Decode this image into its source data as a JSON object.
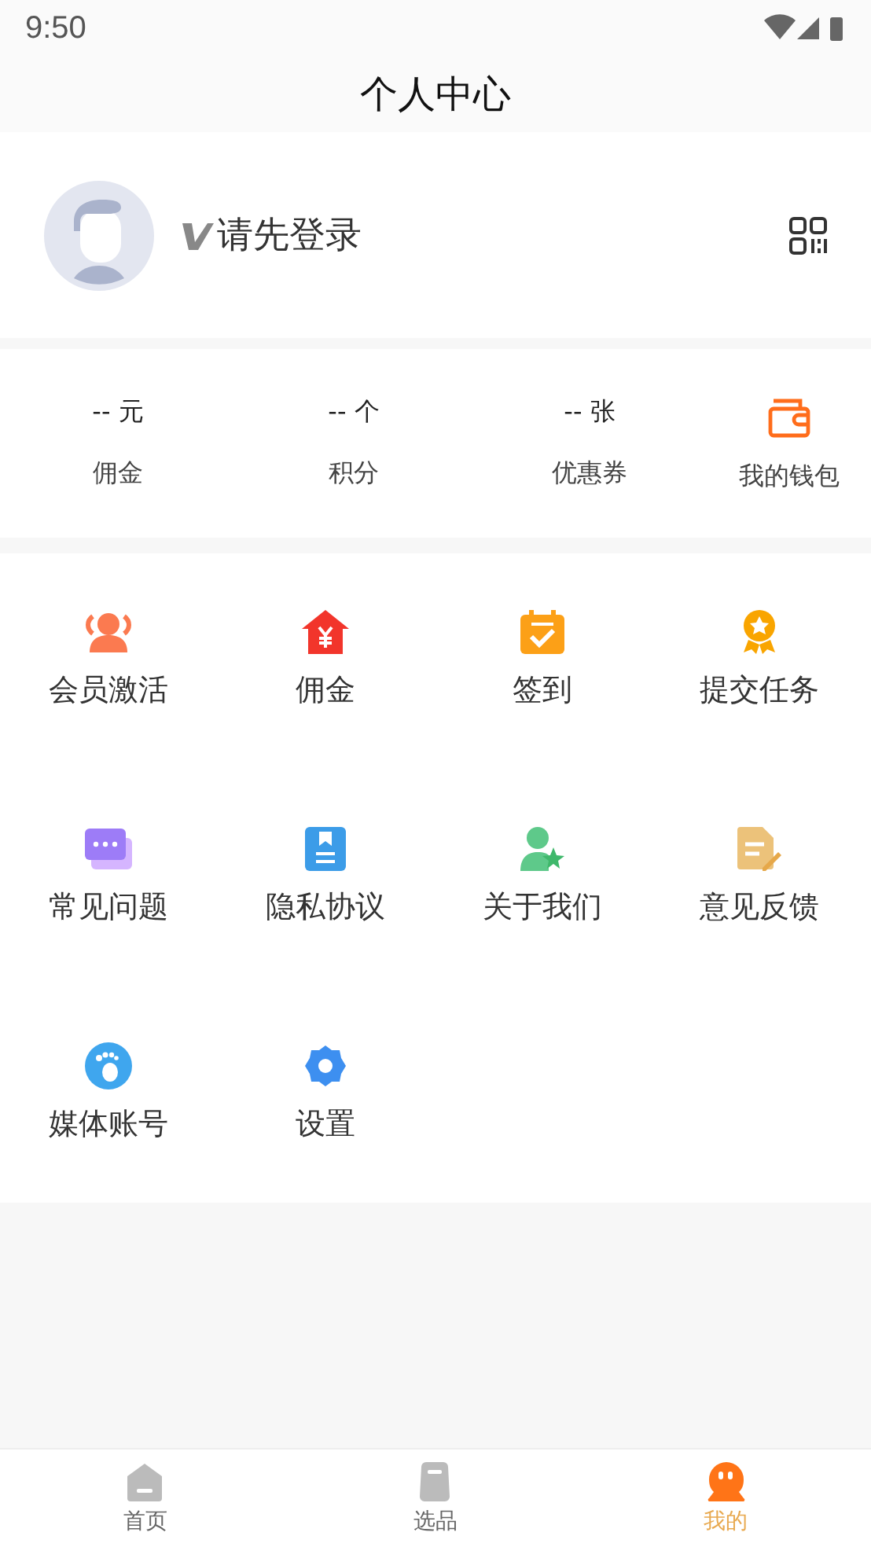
{
  "status_bar": {
    "time": "9:50"
  },
  "header": {
    "title": "个人中心"
  },
  "profile": {
    "login_prompt": "请先登录"
  },
  "stats": [
    {
      "value": "-- 元",
      "label": "佣金"
    },
    {
      "value": "-- 个",
      "label": "积分"
    },
    {
      "value": "-- 张",
      "label": "优惠券"
    }
  ],
  "wallet": {
    "label": "我的钱包"
  },
  "menu": [
    {
      "label": "会员激活"
    },
    {
      "label": "佣金"
    },
    {
      "label": "签到"
    },
    {
      "label": "提交任务"
    },
    {
      "label": "常见问题"
    },
    {
      "label": "隐私协议"
    },
    {
      "label": "关于我们"
    },
    {
      "label": "意见反馈"
    },
    {
      "label": "媒体账号"
    },
    {
      "label": "设置"
    }
  ],
  "tabs": [
    {
      "label": "首页",
      "selected": false
    },
    {
      "label": "选品",
      "selected": false
    },
    {
      "label": "我的",
      "selected": true
    }
  ]
}
